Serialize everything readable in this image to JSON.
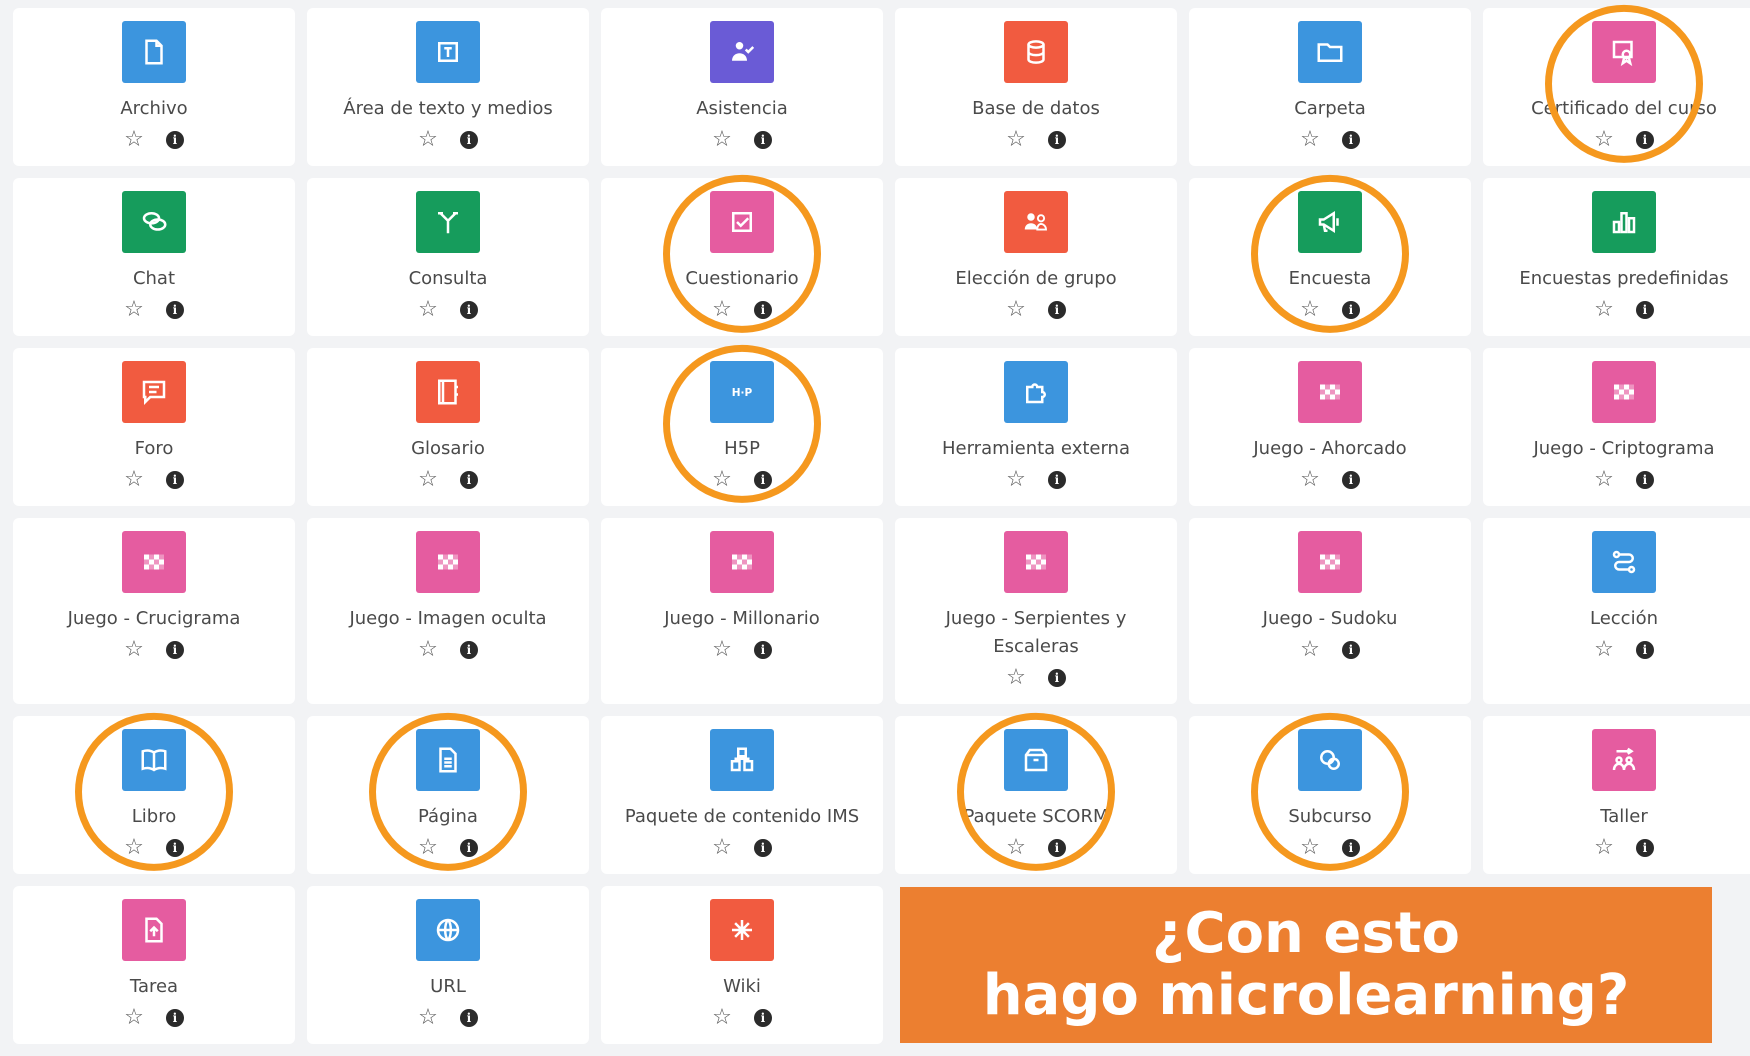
{
  "activities": [
    {
      "label": "Archivo",
      "icon": "file-icon",
      "color": "#3c95de",
      "highlighted": false
    },
    {
      "label": "Área de texto y medios",
      "icon": "text-area-icon",
      "color": "#3c95de",
      "highlighted": false
    },
    {
      "label": "Asistencia",
      "icon": "attendance-icon",
      "color": "#6a5bd6",
      "highlighted": false
    },
    {
      "label": "Base de datos",
      "icon": "database-icon",
      "color": "#f15b40",
      "highlighted": false
    },
    {
      "label": "Carpeta",
      "icon": "folder-icon",
      "color": "#3c95de",
      "highlighted": false
    },
    {
      "label": "Certificado del curso",
      "icon": "certificate-icon",
      "color": "#e55ca0",
      "highlighted": true
    },
    {
      "label": "Chat",
      "icon": "chat-icon",
      "color": "#169c5c",
      "highlighted": false
    },
    {
      "label": "Consulta",
      "icon": "choice-icon",
      "color": "#169c5c",
      "highlighted": false
    },
    {
      "label": "Cuestionario",
      "icon": "quiz-icon",
      "color": "#e55ca0",
      "highlighted": true
    },
    {
      "label": "Elección de grupo",
      "icon": "group-choice-icon",
      "color": "#f15b40",
      "highlighted": false
    },
    {
      "label": "Encuesta",
      "icon": "megaphone-icon",
      "color": "#169c5c",
      "highlighted": true
    },
    {
      "label": "Encuestas predefinidas",
      "icon": "bar-chart-icon",
      "color": "#169c5c",
      "highlighted": false
    },
    {
      "label": "Foro",
      "icon": "forum-icon",
      "color": "#f15b40",
      "highlighted": false
    },
    {
      "label": "Glosario",
      "icon": "glossary-icon",
      "color": "#f15b40",
      "highlighted": false
    },
    {
      "label": "H5P",
      "icon": "h5p-icon",
      "color": "#3c95de",
      "highlighted": true
    },
    {
      "label": "Herramienta externa",
      "icon": "puzzle-icon",
      "color": "#3c95de",
      "highlighted": false
    },
    {
      "label": "Juego - Ahorcado",
      "icon": "game-icon",
      "color": "#e55ca0",
      "highlighted": false
    },
    {
      "label": "Juego - Criptograma",
      "icon": "game-icon",
      "color": "#e55ca0",
      "highlighted": false
    },
    {
      "label": "Juego - Crucigrama",
      "icon": "game-icon",
      "color": "#e55ca0",
      "highlighted": false
    },
    {
      "label": "Juego - Imagen oculta",
      "icon": "game-icon",
      "color": "#e55ca0",
      "highlighted": false
    },
    {
      "label": "Juego - Millonario",
      "icon": "game-icon",
      "color": "#e55ca0",
      "highlighted": false
    },
    {
      "label": "Juego - Serpientes y Escaleras",
      "icon": "game-icon",
      "color": "#e55ca0",
      "highlighted": false
    },
    {
      "label": "Juego - Sudoku",
      "icon": "game-icon",
      "color": "#e55ca0",
      "highlighted": false
    },
    {
      "label": "Lección",
      "icon": "lesson-icon",
      "color": "#3c95de",
      "highlighted": false
    },
    {
      "label": "Libro",
      "icon": "book-icon",
      "color": "#3c95de",
      "highlighted": true
    },
    {
      "label": "Página",
      "icon": "page-icon",
      "color": "#3c95de",
      "highlighted": true
    },
    {
      "label": "Paquete de contenido IMS",
      "icon": "ims-package-icon",
      "color": "#3c95de",
      "highlighted": false
    },
    {
      "label": "Paquete SCORM",
      "icon": "scorm-package-icon",
      "color": "#3c95de",
      "highlighted": true
    },
    {
      "label": "Subcurso",
      "icon": "subcourse-icon",
      "color": "#3c95de",
      "highlighted": true
    },
    {
      "label": "Taller",
      "icon": "workshop-icon",
      "color": "#e55ca0",
      "highlighted": false
    },
    {
      "label": "Tarea",
      "icon": "assignment-icon",
      "color": "#e55ca0",
      "highlighted": false
    },
    {
      "label": "URL",
      "icon": "globe-icon",
      "color": "#3c95de",
      "highlighted": false
    },
    {
      "label": "Wiki",
      "icon": "wiki-icon",
      "color": "#f15b40",
      "highlighted": false
    }
  ],
  "overlay": {
    "line1": "¿Con esto",
    "line2": "hago microlearning?",
    "color": "#ec7f30"
  },
  "highlight_color": "#f5981e"
}
